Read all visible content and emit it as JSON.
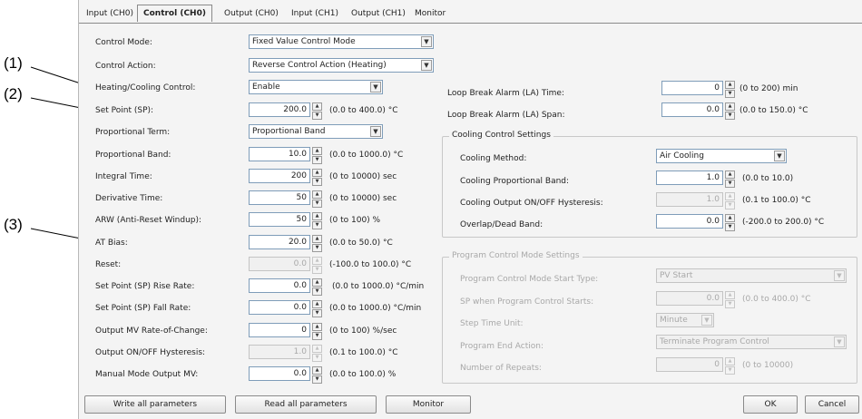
{
  "callouts": [
    "(1)",
    "(2)",
    "(3)"
  ],
  "tabs": [
    "Input (CH0)",
    "Control (CH0)",
    "Output (CH0)",
    "Input (CH1)",
    "Output (CH1)",
    "Monitor"
  ],
  "left": {
    "control_mode": {
      "label": "Control Mode:",
      "value": "Fixed Value Control Mode"
    },
    "control_action": {
      "label": "Control Action:",
      "value": "Reverse Control Action (Heating)"
    },
    "heating_cooling": {
      "label": "Heating/Cooling Control:",
      "value": "Enable"
    },
    "set_point": {
      "label": "Set Point (SP):",
      "value": "200.0",
      "range": "(0.0 to 400.0) °C"
    },
    "proportional_term": {
      "label": "Proportional Term:",
      "value": "Proportional Band"
    },
    "proportional_band": {
      "label": "Proportional Band:",
      "value": "10.0",
      "range": "(0.0 to 1000.0) °C"
    },
    "integral_time": {
      "label": "Integral Time:",
      "value": "200",
      "range": "(0 to 10000) sec"
    },
    "derivative_time": {
      "label": "Derivative Time:",
      "value": "50",
      "range": "(0 to 10000) sec"
    },
    "arw": {
      "label": "ARW (Anti-Reset Windup):",
      "value": "50",
      "range": "(0 to 100) %"
    },
    "at_bias": {
      "label": "AT Bias:",
      "value": "20.0",
      "range": "(0.0 to 50.0) °C"
    },
    "reset": {
      "label": "Reset:",
      "value": "0.0",
      "range": "(-100.0 to 100.0) °C"
    },
    "sp_rise": {
      "label": "Set Point (SP) Rise Rate:",
      "value": "0.0",
      "range": "(0.0 to 1000.0) °C/min"
    },
    "sp_fall": {
      "label": "Set Point (SP) Fall Rate:",
      "value": "0.0",
      "range": "(0.0 to 1000.0) °C/min"
    },
    "mv_rate": {
      "label": "Output MV Rate-of-Change:",
      "value": "0",
      "range": "(0 to 100) %/sec"
    },
    "onoff_hyst": {
      "label": "Output ON/OFF Hysteresis:",
      "value": "1.0",
      "range": "(0.1 to 100.0) °C"
    },
    "manual_mv": {
      "label": "Manual Mode Output MV:",
      "value": "0.0",
      "range": "(0.0 to 100.0) %"
    }
  },
  "right": {
    "la_time": {
      "label": "Loop Break Alarm (LA) Time:",
      "value": "0",
      "range": "(0 to 200) min"
    },
    "la_span": {
      "label": "Loop Break Alarm (LA) Span:",
      "value": "0.0",
      "range": "(0.0 to 150.0) °C"
    },
    "cooling_group": {
      "title": "Cooling Control Settings",
      "method": {
        "label": "Cooling Method:",
        "value": "Air Cooling"
      },
      "prop_band": {
        "label": "Cooling Proportional Band:",
        "value": "1.0",
        "range": "(0.0 to 10.0)"
      },
      "hyst": {
        "label": "Cooling Output ON/OFF Hysteresis:",
        "value": "1.0",
        "range": "(0.1 to 100.0) °C"
      },
      "overlap": {
        "label": "Overlap/Dead Band:",
        "value": "0.0",
        "range": "(-200.0 to 200.0) °C"
      }
    },
    "program_group": {
      "title": "Program Control Mode Settings",
      "start_type": {
        "label": "Program Control Mode Start Type:",
        "value": "PV Start"
      },
      "sp_start": {
        "label": "SP when Program Control Starts:",
        "value": "0.0",
        "range": "(0.0 to 400.0) °C"
      },
      "step_unit": {
        "label": "Step Time Unit:",
        "value": "Minute"
      },
      "end_action": {
        "label": "Program End Action:",
        "value": "Terminate Program Control"
      },
      "repeats": {
        "label": "Number of Repeats:",
        "value": "0",
        "range": "(0 to 10000)"
      }
    }
  },
  "buttons": {
    "write": "Write all parameters",
    "read": "Read all parameters",
    "monitor": "Monitor",
    "ok": "OK",
    "cancel": "Cancel"
  }
}
